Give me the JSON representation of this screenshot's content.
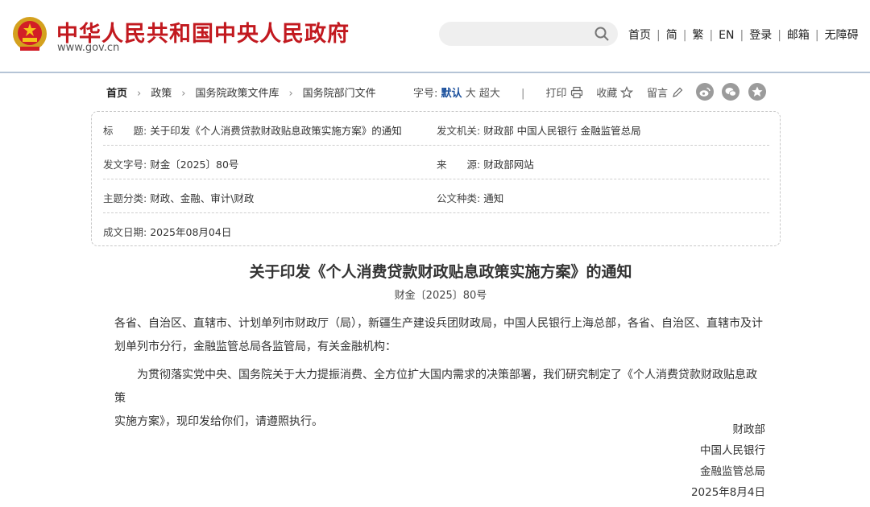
{
  "header": {
    "site_title": "中华人民共和国中央人民政府",
    "site_domain": "www.gov.cn",
    "search": {
      "placeholder": ""
    },
    "nav": [
      "首页",
      "简",
      "繁",
      "EN",
      "登录",
      "邮箱",
      "无障碍"
    ],
    "brand_color": "#c2191f"
  },
  "breadcrumb": [
    "首页",
    "政策",
    "国务院政策文件库",
    "国务院部门文件"
  ],
  "toolbar": {
    "font_size_label": "字号:",
    "font_default": "默认",
    "font_large": "大",
    "font_xlarge": "超大",
    "print_label": "打印",
    "favorite_label": "收藏",
    "comment_label": "留言",
    "share_icons": [
      "weibo-icon",
      "wechat-icon",
      "qzone-icon"
    ]
  },
  "info": {
    "title_label": "标　　题:",
    "title_value": "关于印发《个人消费贷款财政贴息政策实施方案》的通知",
    "issuer_label": "发文机关:",
    "issuer_value": "财政部 中国人民银行 金融监管总局",
    "doc_no_label": "发文字号:",
    "doc_no_value": "财金〔2025〕80号",
    "source_label": "来　　源:",
    "source_value": "财政部网站",
    "topic_label": "主题分类:",
    "topic_value": "财政、金融、审计\\财政",
    "type_label": "公文种类:",
    "type_value": "通知",
    "date_label": "成文日期:",
    "date_value": "2025年08月04日"
  },
  "article": {
    "title": "关于印发《个人消费贷款财政贴息政策实施方案》的通知",
    "doc_number": "财金〔2025〕80号",
    "recipients_line1": "各省、自治区、直辖市、计划单列市财政厅（局），新疆生产建设兵团财政局，中国人民银行上海总部，各省、自治区、直辖市及计",
    "recipients_line2": "划单列市分行，金融监管总局各监管局，有关金融机构：",
    "body_line1": "为贯彻落实党中央、国务院关于大力提振消费、全方位扩大国内需求的决策部署，我们研究制定了《个人消费贷款财政贴息政策",
    "body_line2": "实施方案》，现印发给你们，请遵照执行。",
    "signatories": [
      "财政部",
      "中国人民银行",
      "金融监管总局"
    ],
    "sign_date": "2025年8月4日"
  }
}
